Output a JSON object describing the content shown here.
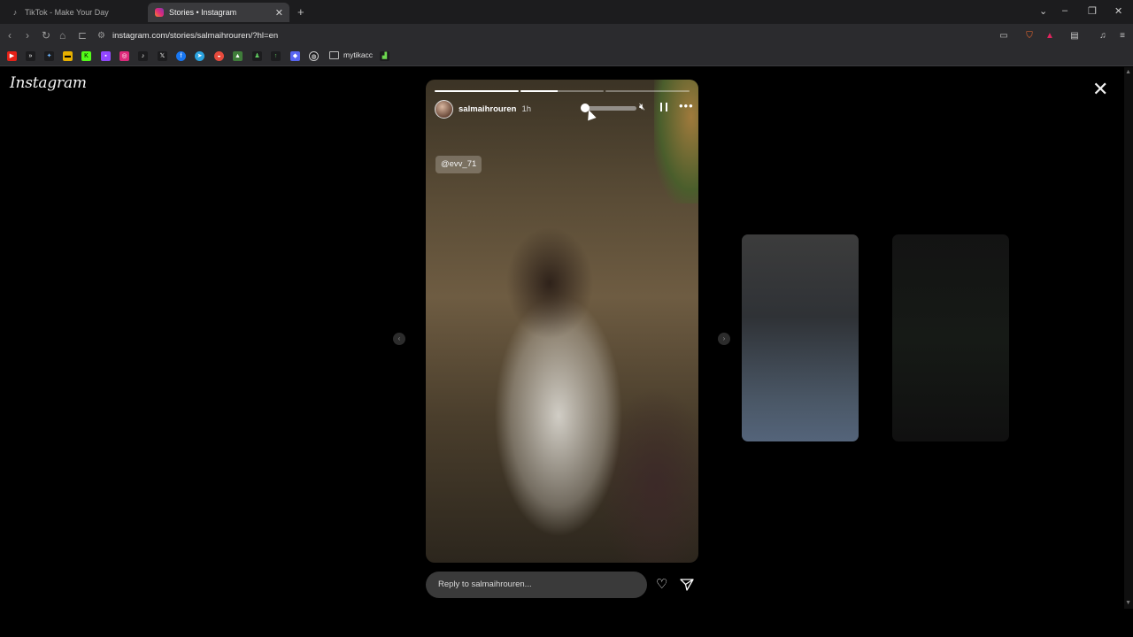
{
  "browser": {
    "tabs": [
      {
        "title": "TikTok - Make Your Day",
        "active": false
      },
      {
        "title": "Stories • Instagram",
        "active": true
      }
    ],
    "url": "instagram.com/stories/salmaihrouren/?hl=en",
    "bookmarks_folder": "mytikacc"
  },
  "page": {
    "logo": "Instagram",
    "story": {
      "username": "salmaihrouren",
      "age": "1h",
      "mention": "@evv_71",
      "progress": [
        1.0,
        0.45,
        0.0
      ],
      "volume": 0.0
    },
    "reply_placeholder": "Reply to salmaihrouren..."
  }
}
